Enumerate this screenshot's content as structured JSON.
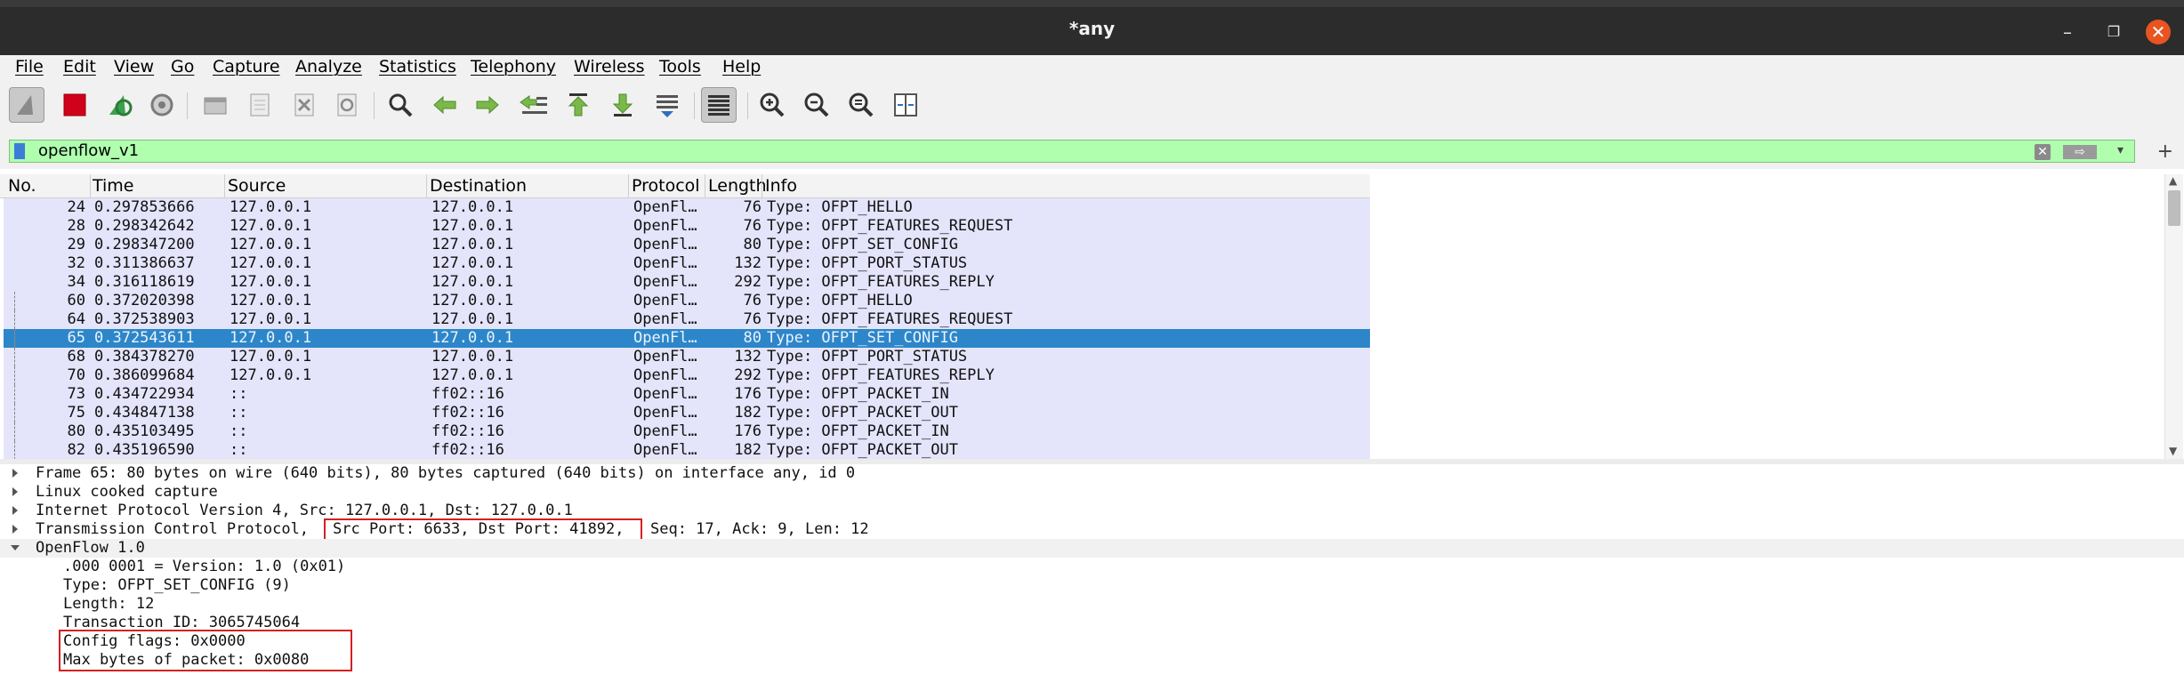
{
  "window": {
    "title": "*any"
  },
  "menu": [
    "File",
    "Edit",
    "View",
    "Go",
    "Capture",
    "Analyze",
    "Statistics",
    "Telephony",
    "Wireless",
    "Tools",
    "Help"
  ],
  "toolbar": {
    "icons": [
      "shark-fin-start-icon",
      "stop-capture-icon",
      "restart-capture-icon",
      "capture-options-icon",
      "open-file-icon",
      "save-file-icon",
      "close-file-icon",
      "reload-icon",
      "find-packet-icon",
      "go-back-icon",
      "go-forward-icon",
      "go-to-packet-icon",
      "go-first-icon",
      "go-last-icon",
      "autoscroll-icon",
      "colorize-icon",
      "zoom-in-icon",
      "zoom-out-icon",
      "zoom-normal-icon",
      "resize-columns-icon"
    ]
  },
  "filter": {
    "value": "openflow_v1"
  },
  "packet_list": {
    "columns": [
      "No.",
      "Time",
      "Source",
      "Destination",
      "Protocol",
      "Length",
      "Info"
    ],
    "rows": [
      {
        "no": "24",
        "time": "0.297853666",
        "src": "127.0.0.1",
        "dst": "127.0.0.1",
        "proto": "OpenFl…",
        "len": "76",
        "info": "Type: OFPT_HELLO"
      },
      {
        "no": "28",
        "time": "0.298342642",
        "src": "127.0.0.1",
        "dst": "127.0.0.1",
        "proto": "OpenFl…",
        "len": "76",
        "info": "Type: OFPT_FEATURES_REQUEST"
      },
      {
        "no": "29",
        "time": "0.298347200",
        "src": "127.0.0.1",
        "dst": "127.0.0.1",
        "proto": "OpenFl…",
        "len": "80",
        "info": "Type: OFPT_SET_CONFIG"
      },
      {
        "no": "32",
        "time": "0.311386637",
        "src": "127.0.0.1",
        "dst": "127.0.0.1",
        "proto": "OpenFl…",
        "len": "132",
        "info": "Type: OFPT_PORT_STATUS"
      },
      {
        "no": "34",
        "time": "0.316118619",
        "src": "127.0.0.1",
        "dst": "127.0.0.1",
        "proto": "OpenFl…",
        "len": "292",
        "info": "Type: OFPT_FEATURES_REPLY"
      },
      {
        "no": "60",
        "time": "0.372020398",
        "src": "127.0.0.1",
        "dst": "127.0.0.1",
        "proto": "OpenFl…",
        "len": "76",
        "info": "Type: OFPT_HELLO"
      },
      {
        "no": "64",
        "time": "0.372538903",
        "src": "127.0.0.1",
        "dst": "127.0.0.1",
        "proto": "OpenFl…",
        "len": "76",
        "info": "Type: OFPT_FEATURES_REQUEST"
      },
      {
        "no": "65",
        "time": "0.372543611",
        "src": "127.0.0.1",
        "dst": "127.0.0.1",
        "proto": "OpenFl…",
        "len": "80",
        "info": "Type: OFPT_SET_CONFIG",
        "selected": true
      },
      {
        "no": "68",
        "time": "0.384378270",
        "src": "127.0.0.1",
        "dst": "127.0.0.1",
        "proto": "OpenFl…",
        "len": "132",
        "info": "Type: OFPT_PORT_STATUS"
      },
      {
        "no": "70",
        "time": "0.386099684",
        "src": "127.0.0.1",
        "dst": "127.0.0.1",
        "proto": "OpenFl…",
        "len": "292",
        "info": "Type: OFPT_FEATURES_REPLY"
      },
      {
        "no": "73",
        "time": "0.434722934",
        "src": "::",
        "dst": "ff02::16",
        "proto": "OpenFl…",
        "len": "176",
        "info": "Type: OFPT_PACKET_IN"
      },
      {
        "no": "75",
        "time": "0.434847138",
        "src": "::",
        "dst": "ff02::16",
        "proto": "OpenFl…",
        "len": "182",
        "info": "Type: OFPT_PACKET_OUT"
      },
      {
        "no": "80",
        "time": "0.435103495",
        "src": "::",
        "dst": "ff02::16",
        "proto": "OpenFl…",
        "len": "176",
        "info": "Type: OFPT_PACKET_IN"
      },
      {
        "no": "82",
        "time": "0.435196590",
        "src": "::",
        "dst": "ff02::16",
        "proto": "OpenFl…",
        "len": "182",
        "info": "Type: OFPT_PACKET_OUT"
      }
    ]
  },
  "details": {
    "frame": "Frame 65: 80 bytes on wire (640 bits), 80 bytes captured (640 bits) on interface any, id 0",
    "linux": "Linux cooked capture",
    "ip": "Internet Protocol Version 4, Src: 127.0.0.1, Dst: 127.0.0.1",
    "tcp_prefix": "Transmission Control Protocol,",
    "tcp_ports": "Src Port: 6633, Dst Port: 41892,",
    "tcp_suffix": "Seq: 17, Ack: 9, Len: 12",
    "openflow": "OpenFlow 1.0",
    "version": ".000 0001 = Version: 1.0 (0x01)",
    "type": "Type: OFPT_SET_CONFIG (9)",
    "length": "Length: 12",
    "xid": "Transaction ID: 3065745064",
    "flags": "Config flags: 0x0000",
    "maxbytes": "Max bytes of packet: 0x0080"
  }
}
